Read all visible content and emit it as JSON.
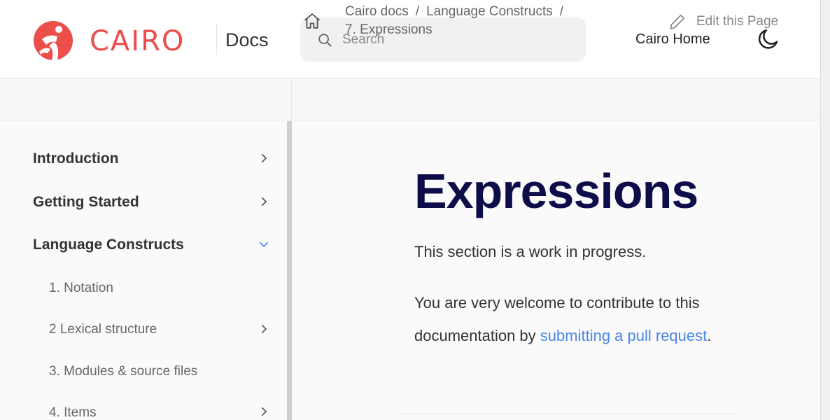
{
  "header": {
    "brand": "CAIRO",
    "section": "Docs",
    "search_placeholder": "Search",
    "home_link": "Cairo Home",
    "theme_toggle_icon": "moon-icon",
    "brand_color": "#ec4e4a"
  },
  "breadcrumb": {
    "items": [
      "Cairo docs",
      "Language Constructs",
      "7. Expressions"
    ],
    "separator": "/",
    "edit_label": "Edit this Page"
  },
  "sidebar": {
    "items": [
      {
        "label": "Introduction",
        "expandable": true,
        "expanded": false
      },
      {
        "label": "Getting Started",
        "expandable": true,
        "expanded": false
      },
      {
        "label": "Language Constructs",
        "expandable": true,
        "expanded": true
      }
    ],
    "sub_items": [
      {
        "label": "1. Notation",
        "expandable": false
      },
      {
        "label": "2 Lexical structure",
        "expandable": true
      },
      {
        "label": "3. Modules & source files",
        "expandable": false
      },
      {
        "label": "4. Items",
        "expandable": true
      }
    ]
  },
  "main": {
    "title": "Expressions",
    "intro": "This section is a work in progress.",
    "contrib_prefix": "You are very welcome to contribute to this documentation by ",
    "contrib_link": "submitting a pull request",
    "contrib_suffix": ".",
    "link_color": "#4a86e8",
    "title_color": "#0d0d4a"
  }
}
